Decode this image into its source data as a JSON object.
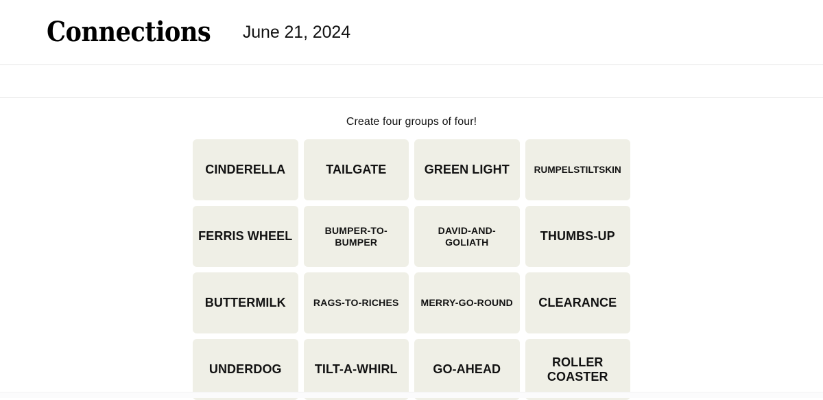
{
  "header": {
    "title": "Connections",
    "date": "June 21, 2024"
  },
  "toolbar": {
    "items": []
  },
  "board": {
    "instruction": "Create four groups of four!",
    "tiles": [
      {
        "label": "CINDERELLA",
        "size": "lg"
      },
      {
        "label": "TAILGATE",
        "size": "lg"
      },
      {
        "label": "GREEN LIGHT",
        "size": "lg"
      },
      {
        "label": "RUMPELSTILTSKIN",
        "size": "xs"
      },
      {
        "label": "FERRIS WHEEL",
        "size": "lg"
      },
      {
        "label": "BUMPER-TO-BUMPER",
        "size": "sm"
      },
      {
        "label": "DAVID-AND-GOLIATH",
        "size": "sm"
      },
      {
        "label": "THUMBS-UP",
        "size": "lg"
      },
      {
        "label": "BUTTERMILK",
        "size": "lg"
      },
      {
        "label": "RAGS-TO-RICHES",
        "size": "sm"
      },
      {
        "label": "MERRY-GO-ROUND",
        "size": "sm"
      },
      {
        "label": "CLEARANCE",
        "size": "lg"
      },
      {
        "label": "UNDERDOG",
        "size": "lg"
      },
      {
        "label": "TILT-A-WHIRL",
        "size": "lg"
      },
      {
        "label": "GO-AHEAD",
        "size": "lg"
      },
      {
        "label": "ROLLER COASTER",
        "size": "lg"
      }
    ]
  },
  "colors": {
    "tile_background": "#EFEFE6",
    "page_background": "#FFFFFF",
    "text": "#121212",
    "divider": "#E6E6E6"
  }
}
